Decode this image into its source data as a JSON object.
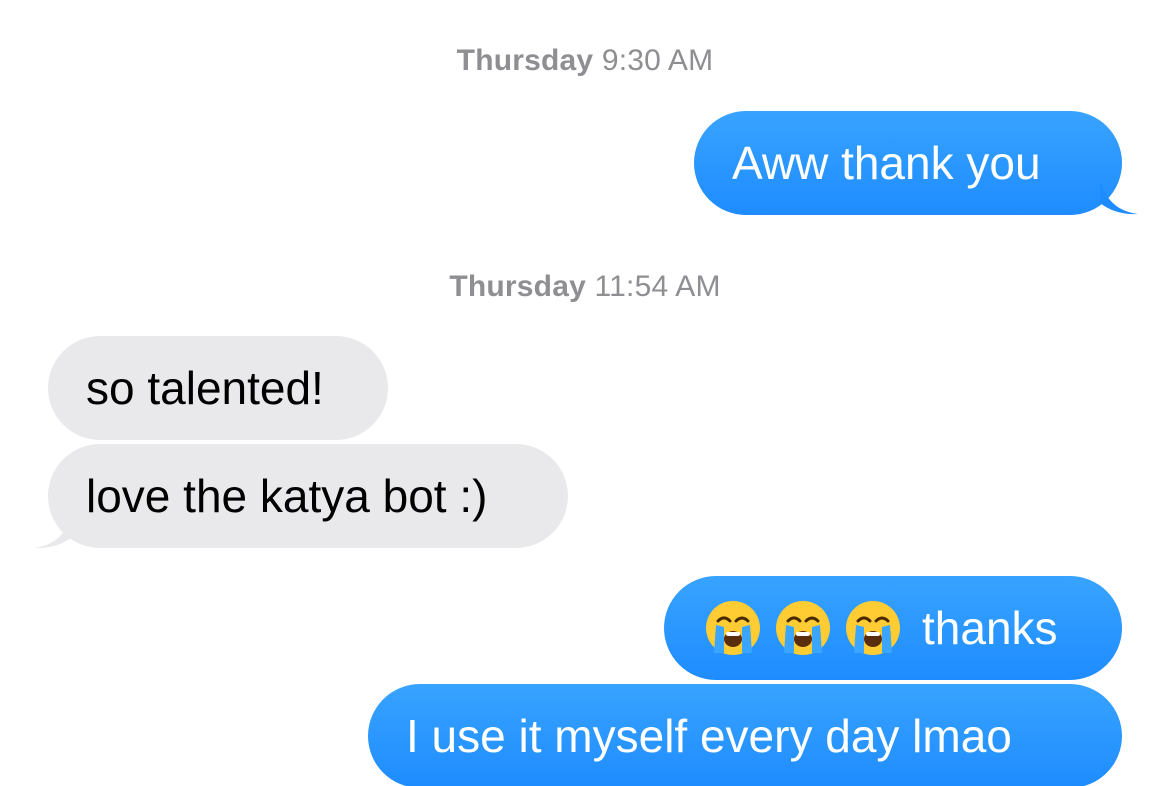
{
  "thread": {
    "timestamps": [
      {
        "day": "Thursday",
        "time": "9:30 AM"
      },
      {
        "day": "Thursday",
        "time": "11:54 AM"
      }
    ],
    "messages": [
      {
        "sender": "me",
        "text": "Aww thank you"
      },
      {
        "sender": "them",
        "text": "so talented!"
      },
      {
        "sender": "them",
        "text": "love the katya bot :)"
      },
      {
        "sender": "me",
        "emoji": [
          "loudly-crying-face",
          "loudly-crying-face",
          "loudly-crying-face"
        ],
        "text": "thanks"
      },
      {
        "sender": "me",
        "text": "I use it myself every day lmao"
      }
    ]
  },
  "colors": {
    "sent_bubble": "#1e8cff",
    "received_bubble": "#e9e9eb",
    "timestamp": "#8e8e93"
  }
}
